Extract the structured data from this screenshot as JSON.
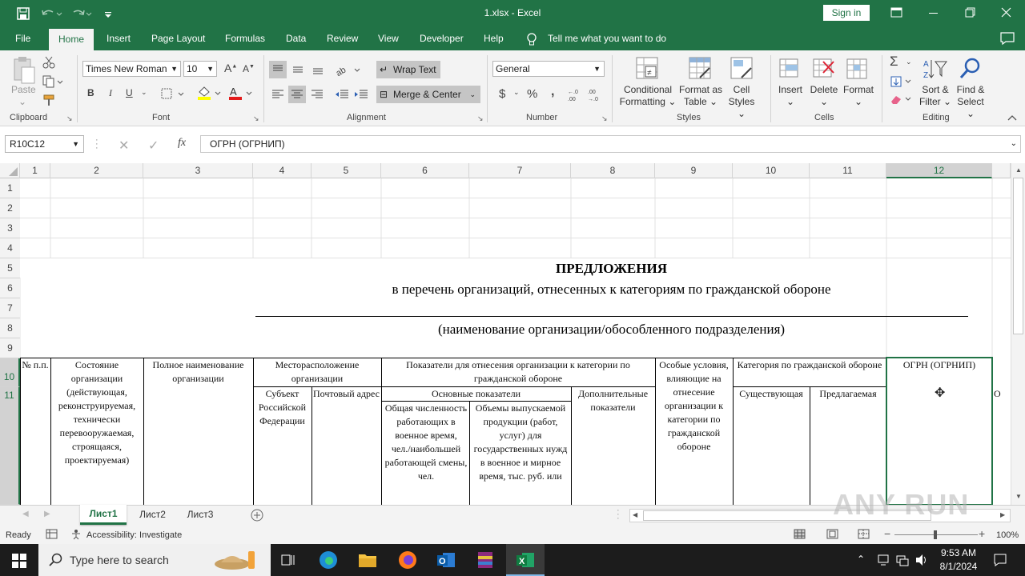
{
  "window": {
    "title": "1.xlsx  -  Excel",
    "sign_in": "Sign in"
  },
  "tabs": [
    "File",
    "Home",
    "Insert",
    "Page Layout",
    "Formulas",
    "Data",
    "Review",
    "View",
    "Developer",
    "Help"
  ],
  "tell_me": "Tell me what you want to do",
  "ribbon": {
    "clipboard": {
      "paste": "Paste",
      "group": "Clipboard"
    },
    "font": {
      "name": "Times New Roman",
      "size": "10",
      "group": "Font",
      "bold": "B",
      "italic": "I",
      "underline": "U"
    },
    "alignment": {
      "wrap": "Wrap Text",
      "merge": "Merge & Center",
      "group": "Alignment"
    },
    "number": {
      "format": "General",
      "currency": "$",
      "percent": "%",
      "comma": ",",
      "group": "Number"
    },
    "styles": {
      "conditional": "Conditional",
      "formatting": "Formatting",
      "format_as": "Format as",
      "table": "Table",
      "cell": "Cell",
      "cell_styles": "Styles",
      "group": "Styles"
    },
    "cells": {
      "insert": "Insert",
      "delete": "Delete",
      "format": "Format",
      "group": "Cells"
    },
    "editing": {
      "sort": "Sort &",
      "filter": "Filter",
      "find": "Find &",
      "select": "Select",
      "sum": "Σ",
      "group": "Editing"
    }
  },
  "formula_bar": {
    "name_box": "R10C12",
    "fx": "fx",
    "content": "ОГРН (ОГРНИП)"
  },
  "columns": [
    "1",
    "2",
    "3",
    "4",
    "5",
    "6",
    "7",
    "8",
    "9",
    "10",
    "11",
    "12"
  ],
  "rows": [
    "1",
    "2",
    "3",
    "4",
    "5",
    "6",
    "7",
    "8",
    "9",
    "10",
    "11"
  ],
  "sheet_text": {
    "heading": "ПРЕДЛОЖЕНИЯ",
    "subheading": "в перечень организаций, отнесенных к категориям по гражданской обороне",
    "org_caption": "(наименование организации/обособленного подразделения)",
    "h_num": "№ п.п.",
    "h_state": "Состояние организации (действующая, реконструируемая, технически перевооружаемая, строящаяся, проектируемая)",
    "h_fullname": "Полное наименование организации",
    "h_location": "Месторасположение организации",
    "h_subject": "Субъект Российской Федерации",
    "h_address": "Почтовый адрес",
    "h_indicators": "Показатели для отнесения организации к категории по гражданской обороне",
    "h_main": "Основные показатели",
    "h_staff": "Общая численность работающих в военное время, чел./наибольшей работающей смены, чел.",
    "h_volume": "Объемы выпускаемой продукции (работ, услуг) для государственных нужд в военное и мирное время, тыс. руб. или",
    "h_extra": "Дополнительные показатели",
    "h_special": "Особые условия, влияющие на отнесение организации к категории по гражданской обороне",
    "h_category": "Категория по гражданской обороне",
    "h_existing": "Существующая",
    "h_proposed": "Предлагаемая",
    "h_ogrn": "ОГРН (ОГРНИП)",
    "h_next": "О"
  },
  "sheets": [
    "Лист1",
    "Лист2",
    "Лист3"
  ],
  "status": {
    "ready": "Ready",
    "accessibility": "Accessibility: Investigate",
    "zoom": "100%"
  },
  "taskbar": {
    "search": "Type here to search",
    "time": "9:53 AM",
    "date": "8/1/2024"
  },
  "watermark": "ANY RUN"
}
